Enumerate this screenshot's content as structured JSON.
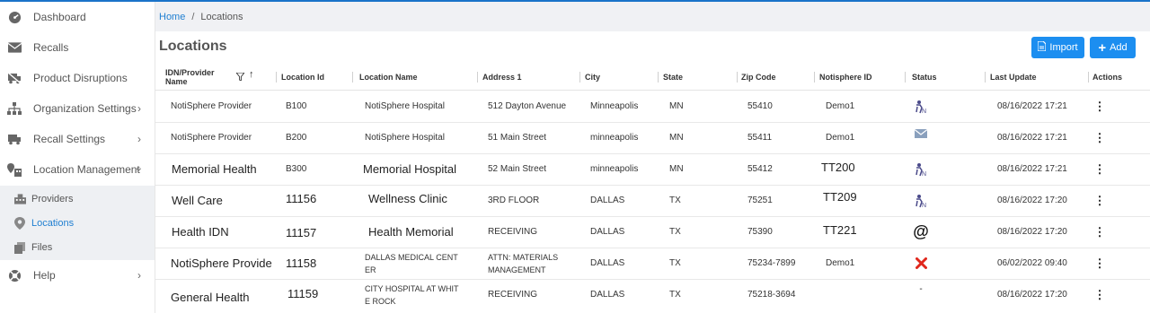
{
  "sidebar": {
    "items": [
      {
        "label": "Dashboard"
      },
      {
        "label": "Recalls"
      },
      {
        "label": "Product Disruptions"
      },
      {
        "label": "Organization Settings"
      },
      {
        "label": "Recall Settings"
      },
      {
        "label": "Location Management"
      },
      {
        "label": "Help"
      }
    ],
    "subitems": [
      {
        "label": "Providers"
      },
      {
        "label": "Locations"
      },
      {
        "label": "Files"
      }
    ]
  },
  "breadcrumb": {
    "home": "Home",
    "separator": "/",
    "current": "Locations"
  },
  "page": {
    "title": "Locations",
    "import_label": "Import",
    "add_label": "Add"
  },
  "colors": {
    "accent": "#1c8ef0",
    "link": "#1f7fd1",
    "error": "#e0271c"
  },
  "table": {
    "headers": [
      "IDN/Provider Name",
      "Location Id",
      "Location Name",
      "Address 1",
      "City",
      "State",
      "Zip Code",
      "Notisphere ID",
      "Status",
      "Last Update",
      "Actions"
    ],
    "rows": [
      {
        "idn": "NotiSphere Provider",
        "loc_id": "B100",
        "loc_name": "NotiSphere Hospital",
        "address": "512 Dayton Avenue",
        "city": "Minneapolis",
        "state": "MN",
        "zip": "55410",
        "noti_id": "Demo1",
        "status": "notisphere-icon",
        "updated": "08/16/2022 17:21",
        "actions": "⋮"
      },
      {
        "idn": "NotiSphere Provider",
        "loc_id": "B200",
        "loc_name": "NotiSphere Hospital",
        "address": "51 Main Street",
        "city": "minneapolis",
        "state": "MN",
        "zip": "55411",
        "noti_id": "Demo1",
        "status": "envelope-icon",
        "updated": "08/16/2022 17:21",
        "actions": "⋮"
      },
      {
        "idn": "Memorial Health",
        "loc_id": "B300",
        "loc_name": "Memorial Hospital",
        "address": "52 Main Street",
        "city": "minneapolis",
        "state": "MN",
        "zip": "55412",
        "noti_id": "TT200",
        "status": "notisphere-icon",
        "updated": "08/16/2022 17:21",
        "actions": "⋮"
      },
      {
        "idn": "Well Care",
        "loc_id": "11156",
        "loc_name": "Wellness Clinic",
        "address": "3RD FLOOR",
        "city": "DALLAS",
        "state": "TX",
        "zip": "75251",
        "noti_id": "TT209",
        "status": "notisphere-icon",
        "updated": "08/16/2022 17:20",
        "actions": "⋮"
      },
      {
        "idn": "Health IDN",
        "loc_id": "11157",
        "loc_name": "Health Memorial",
        "address": "RECEIVING",
        "city": "DALLAS",
        "state": "TX",
        "zip": "75390",
        "noti_id": "TT221",
        "status": "at-icon",
        "status_text": "@",
        "updated": "08/16/2022 17:20",
        "actions": "⋮"
      },
      {
        "idn": "NotiSphere Provide",
        "loc_id": "11158",
        "loc_name": "DALLAS MEDICAL CENTER",
        "loc_name_l1": "DALLAS MEDICAL CENT",
        "loc_name_l2": "ER",
        "address": "ATTN: MATERIALS MANAGEMENT",
        "address_l1": "ATTN: MATERIALS",
        "address_l2": "MANAGEMENT",
        "city": "DALLAS",
        "state": "TX",
        "zip": "75234-7899",
        "noti_id": "Demo1",
        "status": "x-icon",
        "updated": "06/02/2022 09:40",
        "actions": "⋮"
      },
      {
        "idn": "General Health",
        "loc_id": "11159",
        "loc_name": "CITY HOSPITAL AT WHITE ROCK",
        "loc_name_l1": "CITY HOSPITAL AT WHIT",
        "loc_name_l2": "E ROCK",
        "address": "RECEIVING",
        "city": "DALLAS",
        "state": "TX",
        "zip": "75218-3694",
        "noti_id": "",
        "status": "dash-icon",
        "status_text": "-",
        "updated": "08/16/2022 17:20",
        "actions": "⋮"
      }
    ]
  }
}
